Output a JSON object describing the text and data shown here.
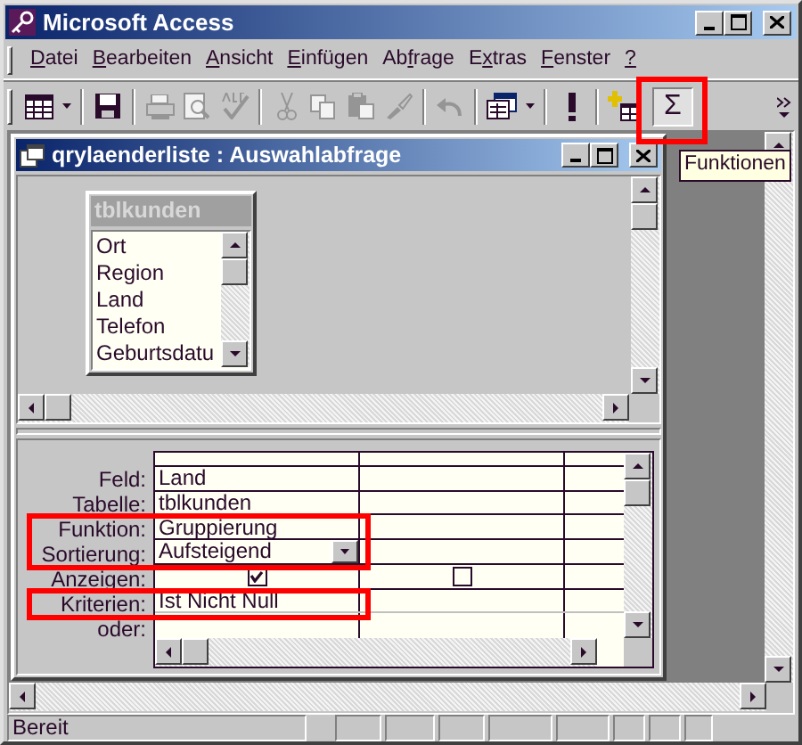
{
  "window": {
    "title": "Microsoft Access"
  },
  "menu": [
    {
      "key": "D",
      "rest": "atei"
    },
    {
      "key": "B",
      "rest": "earbeiten"
    },
    {
      "key": "A",
      "rest": "nsicht"
    },
    {
      "key": "E",
      "rest": "infügen"
    },
    {
      "pre": "Ab",
      "key": "f",
      "rest": "rage"
    },
    {
      "pre": "E",
      "key": "x",
      "rest": "tras"
    },
    {
      "key": "F",
      "rest": "enster"
    },
    {
      "key": "?"
    }
  ],
  "toolbar": [
    {
      "kind": "view",
      "disabled": false
    },
    {
      "kind": "sep"
    },
    {
      "kind": "save",
      "disabled": false
    },
    {
      "kind": "sep"
    },
    {
      "kind": "print",
      "disabled": true
    },
    {
      "kind": "preview",
      "disabled": true
    },
    {
      "kind": "spell",
      "disabled": true
    },
    {
      "kind": "sep"
    },
    {
      "kind": "cut",
      "disabled": true
    },
    {
      "kind": "copy",
      "disabled": true
    },
    {
      "kind": "paste",
      "disabled": true
    },
    {
      "kind": "brush",
      "disabled": true
    },
    {
      "kind": "sep"
    },
    {
      "kind": "undo",
      "disabled": true
    },
    {
      "kind": "sep"
    },
    {
      "kind": "objects",
      "disabled": false
    },
    {
      "kind": "sep"
    },
    {
      "kind": "run",
      "disabled": false
    },
    {
      "kind": "sep"
    },
    {
      "kind": "addtable",
      "disabled": false
    },
    {
      "kind": "text",
      "label": "Σ",
      "pressed": true,
      "highlighted": true
    }
  ],
  "tooltip": "Funktionen",
  "query_window": {
    "title": "qrylaenderliste : Auswahlabfrage",
    "table": {
      "title": "tblkunden",
      "fields": [
        "Ort",
        "Region",
        "Land",
        "Telefon",
        "Geburtsdatu"
      ]
    },
    "grid": {
      "rows": [
        {
          "label": "Feld:",
          "kind": "text",
          "cells": [
            "Land"
          ]
        },
        {
          "label": "Tabelle:",
          "kind": "text",
          "cells": [
            "tblkunden"
          ]
        },
        {
          "label": "Funktion:",
          "kind": "text",
          "cells": [
            "Gruppierung"
          ],
          "highlighted": true
        },
        {
          "label": "Sortierung:",
          "kind": "dropdown",
          "cells": [
            "Aufsteigend"
          ],
          "highlighted": true
        },
        {
          "label": "Anzeigen:",
          "kind": "checkbox",
          "checks": [
            true,
            false
          ]
        },
        {
          "label": "Kriterien:",
          "kind": "text",
          "cells": [
            "Ist Nicht Null"
          ],
          "highlighted": true
        },
        {
          "label": "oder:",
          "kind": "text"
        }
      ]
    }
  },
  "status_bar": {
    "text": "Bereit"
  }
}
